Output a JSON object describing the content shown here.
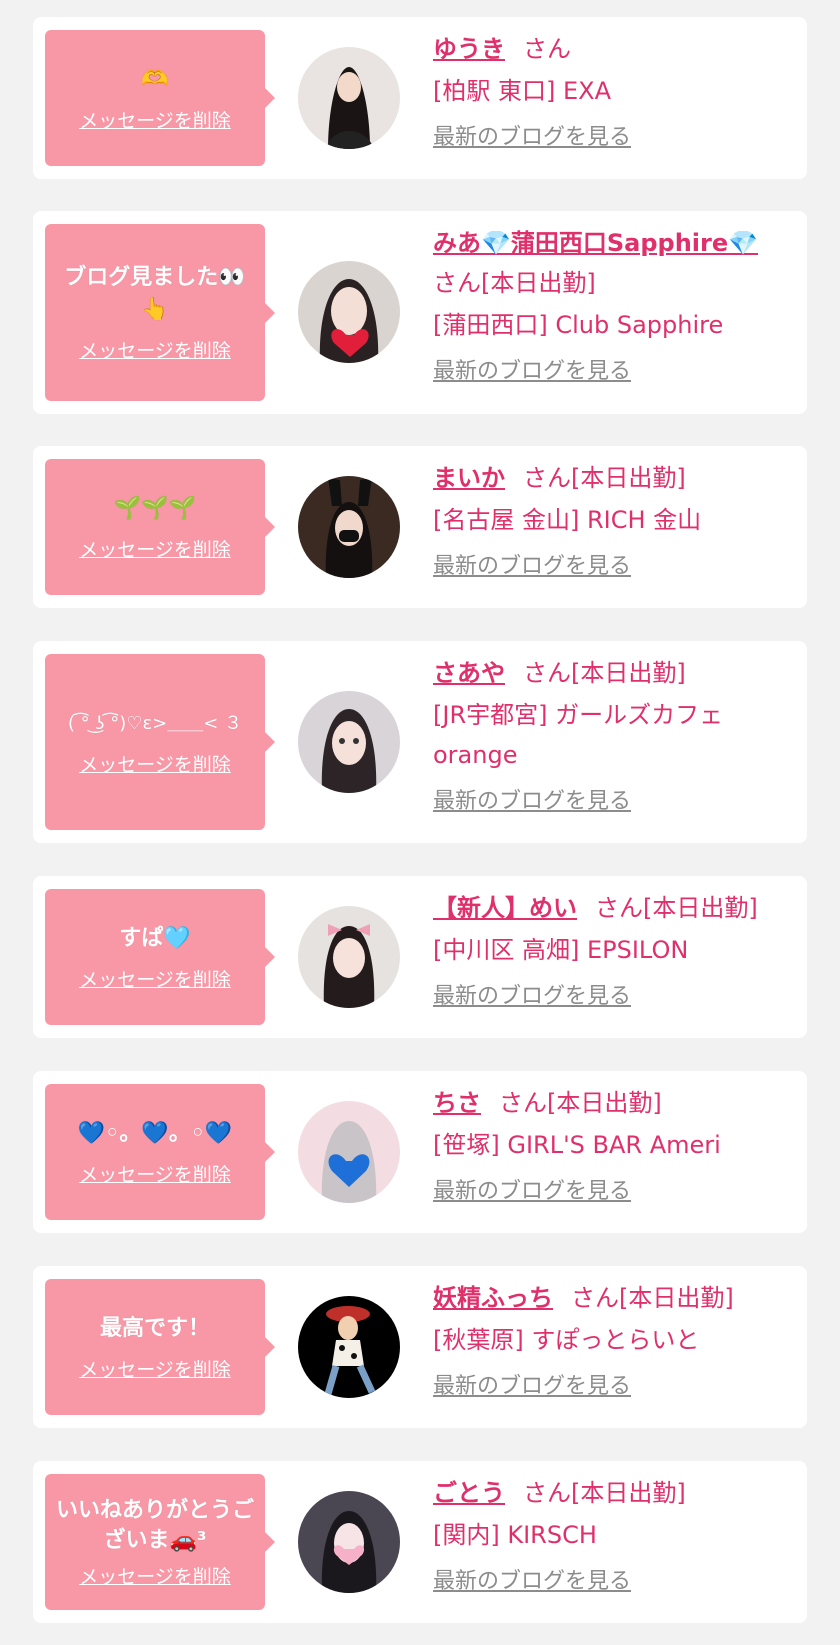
{
  "common": {
    "delete_label": "メッセージを削除",
    "blog_label": "最新のブログを見る"
  },
  "cards": [
    {
      "message": "🫶",
      "name": "ゆうき",
      "suffix": "さん",
      "shop": "[柏駅 東口] EXA",
      "avatar_icon": "woman-portrait"
    },
    {
      "message": "ブログ見ました👀👆",
      "name": "みあ💎蒲田西口Sapphire💎",
      "suffix": "さん[本日出勤]",
      "shop": "[蒲田西口] Club Sapphire",
      "avatar_icon": "heart-face"
    },
    {
      "message": "🌱🌱🌱",
      "name": "まいか",
      "suffix": "さん[本日出勤]",
      "shop": "[名古屋 金山] RICH 金山",
      "avatar_icon": "bunny-girl"
    },
    {
      "message": "( ͡° ͜ʖ ͡°)♡ε>＿＿< ３",
      "name": "さあや",
      "suffix": "さん[本日出勤]",
      "shop": "[JR宇都宮] ガールズカフェ orange",
      "avatar_icon": "girl-portrait"
    },
    {
      "message": "すぱ🩵",
      "name": "【新人】めい",
      "suffix": "さん[本日出勤]",
      "shop": "[中川区 高畑] EPSILON",
      "avatar_icon": "girl-ribbon"
    },
    {
      "message": "💙◦。💙。◦💙",
      "name": "ちさ",
      "suffix": "さん[本日出勤]",
      "shop": "[笹塚] GIRL'S BAR Ameri",
      "avatar_icon": "blue-heart-face"
    },
    {
      "message": "最高です！",
      "name": "妖精ふっち",
      "suffix": "さん[本日出勤]",
      "shop": "[秋葉原] すぽっとらいと",
      "avatar_icon": "cowgirl-character"
    },
    {
      "message": "いいねありがとうございま🚗³",
      "name": "ごとう",
      "suffix": "さん[本日出勤]",
      "shop": "[関内] KIRSCH",
      "avatar_icon": "dark-hair-girl"
    }
  ],
  "colors": {
    "background": "#f2f2f2",
    "card": "#ffffff",
    "bubble": "#f898a6",
    "accent": "#e0306c",
    "link_gray": "#8c8c8c"
  }
}
